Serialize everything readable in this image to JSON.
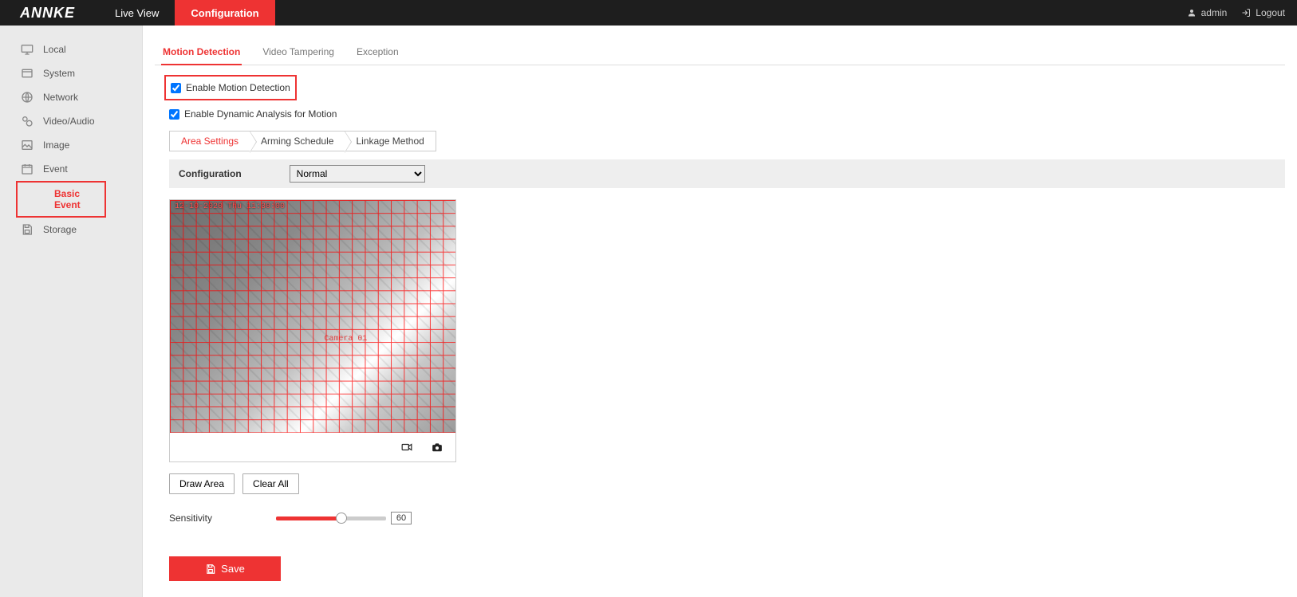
{
  "header": {
    "logo": "ANNKE",
    "nav": {
      "live_view": "Live View",
      "configuration": "Configuration"
    },
    "user": "admin",
    "logout": "Logout"
  },
  "sidebar": {
    "items": [
      {
        "key": "local",
        "label": "Local"
      },
      {
        "key": "system",
        "label": "System"
      },
      {
        "key": "network",
        "label": "Network"
      },
      {
        "key": "video_audio",
        "label": "Video/Audio"
      },
      {
        "key": "image",
        "label": "Image"
      },
      {
        "key": "event",
        "label": "Event"
      },
      {
        "key": "storage",
        "label": "Storage"
      }
    ],
    "event_sub": "Basic Event"
  },
  "subtabs": {
    "motion_detection": "Motion Detection",
    "video_tampering": "Video Tampering",
    "exception": "Exception"
  },
  "checkboxes": {
    "enable_motion": "Enable Motion Detection",
    "enable_dynamic": "Enable Dynamic Analysis for Motion"
  },
  "arrow_tabs": {
    "area_settings": "Area Settings",
    "arming_schedule": "Arming Schedule",
    "linkage_method": "Linkage Method"
  },
  "config_row": {
    "label": "Configuration",
    "options": [
      "Normal"
    ],
    "selected": "Normal"
  },
  "video": {
    "timestamp": "12-10-2020 Thu 11:30:00",
    "camera": "Camera 01"
  },
  "buttons": {
    "draw_area": "Draw Area",
    "clear_all": "Clear All"
  },
  "sensitivity": {
    "label": "Sensitivity",
    "value": "60"
  },
  "save": "Save"
}
